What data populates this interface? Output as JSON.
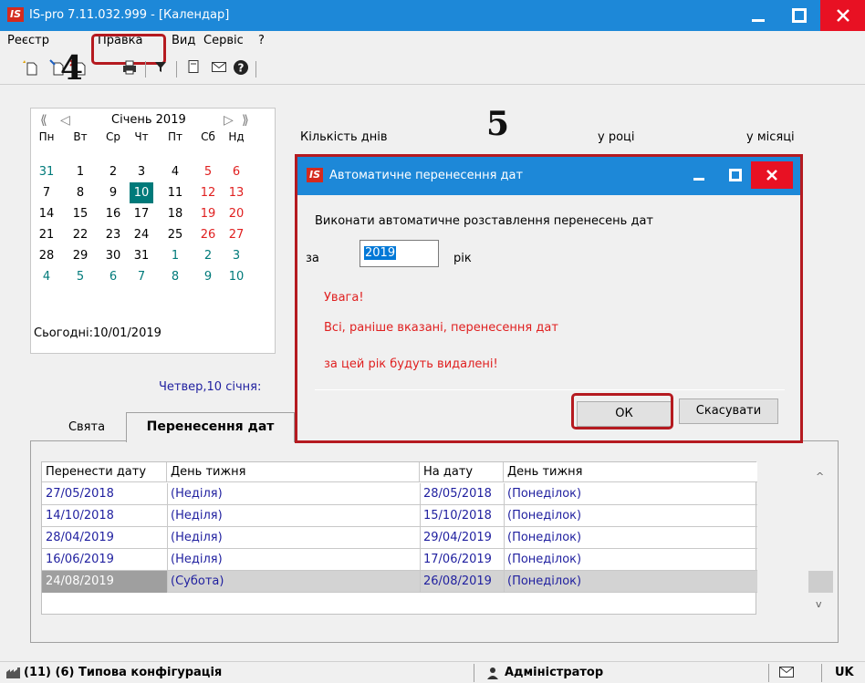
{
  "window": {
    "logo": "IS",
    "title": "IS-pro 7.11.032.999 - [Календар]",
    "minimize_icon": "minimize-icon",
    "maximize_icon": "maximize-icon",
    "close_icon": "close-icon"
  },
  "menu": {
    "items": [
      {
        "label": "Реєстр"
      },
      {
        "label": "Правка"
      },
      {
        "label": "Вид"
      },
      {
        "label": "Сервіс"
      },
      {
        "label": "?"
      }
    ],
    "highlight_number": "4"
  },
  "toolbar": {
    "icons": [
      "new-doc-icon",
      "edit-doc-icon",
      "delete-doc-icon",
      "print-icon",
      "filter-icon",
      "form-icon",
      "mail-icon",
      "help-icon"
    ]
  },
  "calendar": {
    "month_label": "Січень 2019",
    "weekdays": [
      "Пн",
      "Вт",
      "Ср",
      "Чт",
      "Пт",
      "Сб",
      "Нд"
    ],
    "weeks": [
      [
        "31",
        "1",
        "2",
        "3",
        "4",
        "5",
        "6"
      ],
      [
        "7",
        "8",
        "9",
        "10",
        "11",
        "12",
        "13"
      ],
      [
        "14",
        "15",
        "16",
        "17",
        "18",
        "19",
        "20"
      ],
      [
        "21",
        "22",
        "23",
        "24",
        "25",
        "26",
        "27"
      ],
      [
        "28",
        "29",
        "30",
        "31",
        "1",
        "2",
        "3"
      ],
      [
        "4",
        "5",
        "6",
        "7",
        "8",
        "9",
        "10"
      ]
    ],
    "today_label": "Сьогодні:10/01/2019",
    "colors": {
      "weekend": "#e02020",
      "other_month": "#007a7a",
      "today_bg": "#007a7a"
    }
  },
  "summary": {
    "days_count_label": "Кількість днів",
    "in_year_label": "у році",
    "in_month_label": "у місяці",
    "highlight_number": "5"
  },
  "selected_date_label": "Четвер,10 січня:",
  "tabs": [
    {
      "label": "Свята"
    },
    {
      "label": "Перенесення дат"
    }
  ],
  "grid": {
    "columns": [
      "Перенести дату",
      "День тижня",
      "На дату",
      "День тижня"
    ],
    "rows": [
      {
        "from_date": "27/05/2018",
        "from_day": "(Неділя)",
        "to_date": "28/05/2018",
        "to_day": "(Понеділок)"
      },
      {
        "from_date": "14/10/2018",
        "from_day": "(Неділя)",
        "to_date": "15/10/2018",
        "to_day": "(Понеділок)"
      },
      {
        "from_date": "28/04/2019",
        "from_day": "(Неділя)",
        "to_date": "29/04/2019",
        "to_day": "(Понеділок)"
      },
      {
        "from_date": "16/06/2019",
        "from_day": "(Неділя)",
        "to_date": "17/06/2019",
        "to_day": "(Понеділок)"
      },
      {
        "from_date": "24/08/2019",
        "from_day": "(Субота)",
        "to_date": "26/08/2019",
        "to_day": "(Понеділок)"
      }
    ]
  },
  "dialog": {
    "logo": "IS",
    "title": "Автоматичне перенесення дат",
    "prompt": "Виконати автоматичне розставлення перенесень дат",
    "for_label": "за",
    "year_value": "2019",
    "year_suffix": "рік",
    "warning_title": "Увага!",
    "warning_line1": "Всі, раніше вказані, перенесення дат",
    "warning_line2": "за цей рік будуть видалені!",
    "ok_label": "ОК",
    "cancel_label": "Скасувати",
    "warning_color": "#e02020"
  },
  "status": {
    "config": "(11) (6) Типова конфігурація",
    "user": "Адміністратор",
    "lang": "UK"
  }
}
